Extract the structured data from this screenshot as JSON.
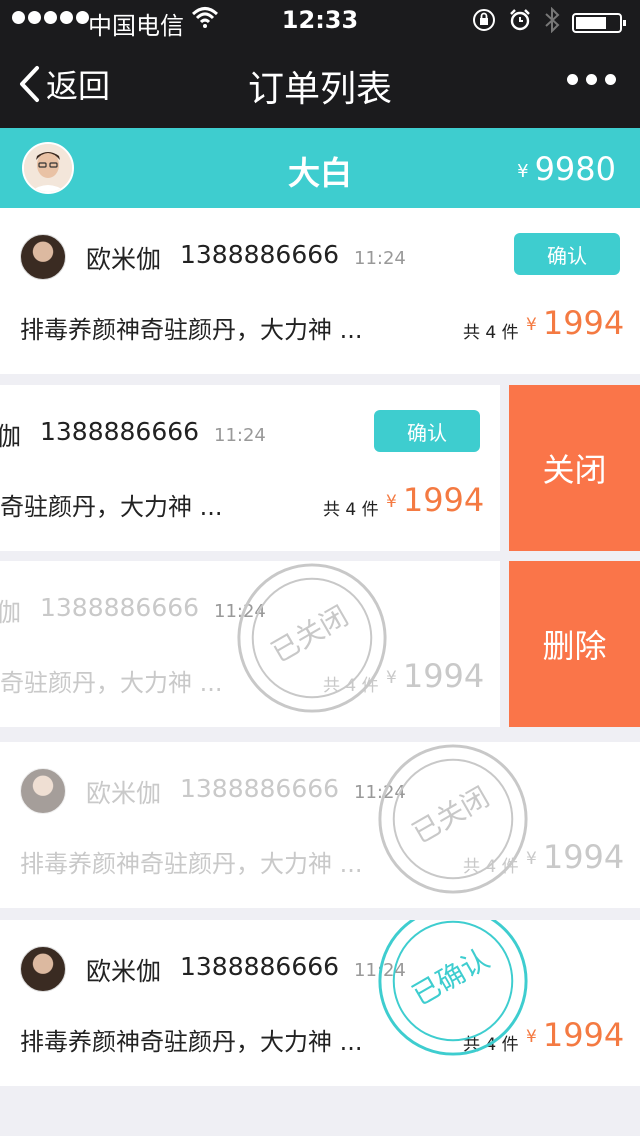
{
  "status": {
    "carrier": "中国电信",
    "time": "12:33"
  },
  "nav": {
    "back_label": "返回",
    "title": "订单列表"
  },
  "user": {
    "name": "大白",
    "currency": "¥",
    "balance": "9980"
  },
  "orders": [
    {
      "name": "欧米伽",
      "phone": "1388886666",
      "time": "11:24",
      "confirm_label": "确认",
      "desc": "排毒养颜神奇驻颜丹，大力神 ...",
      "count": "共 4 件",
      "currency": "¥",
      "price": "1994"
    },
    {
      "name": "欧米伽",
      "phone": "1388886666",
      "time": "11:24",
      "confirm_label": "确认",
      "desc": "排毒养颜神奇驻颜丹，大力神 ...",
      "count": "共 4 件",
      "currency": "¥",
      "price": "1994",
      "action_label": "关闭"
    },
    {
      "name": "欧米伽",
      "phone": "1388886666",
      "time": "11:24",
      "desc": "排毒养颜神奇驻颜丹，大力神 ...",
      "count": "共 4 件",
      "currency": "¥",
      "price": "1994",
      "action_label": "删除",
      "stamp": "已关闭"
    },
    {
      "name": "欧米伽",
      "phone": "1388886666",
      "time": "11:24",
      "desc": "排毒养颜神奇驻颜丹，大力神 ...",
      "count": "共 4 件",
      "currency": "¥",
      "price": "1994",
      "stamp": "已关闭"
    },
    {
      "name": "欧米伽",
      "phone": "1388886666",
      "time": "11:24",
      "desc": "排毒养颜神奇驻颜丹，大力神 ...",
      "count": "共 4 件",
      "currency": "¥",
      "price": "1994",
      "stamp": "已确认"
    }
  ],
  "colors": {
    "accent": "#3ecdcf",
    "price": "#f47a42",
    "action": "#fa7549",
    "header": "#1b1b1d",
    "muted_text": "#c9c9c9",
    "closed_stamp": "#c8c8c8"
  },
  "icons": [
    "signal-dots-icon",
    "wifi-icon",
    "orientation-lock-icon",
    "alarm-icon",
    "bluetooth-icon",
    "battery-icon",
    "back-chevron-icon",
    "more-icon"
  ]
}
